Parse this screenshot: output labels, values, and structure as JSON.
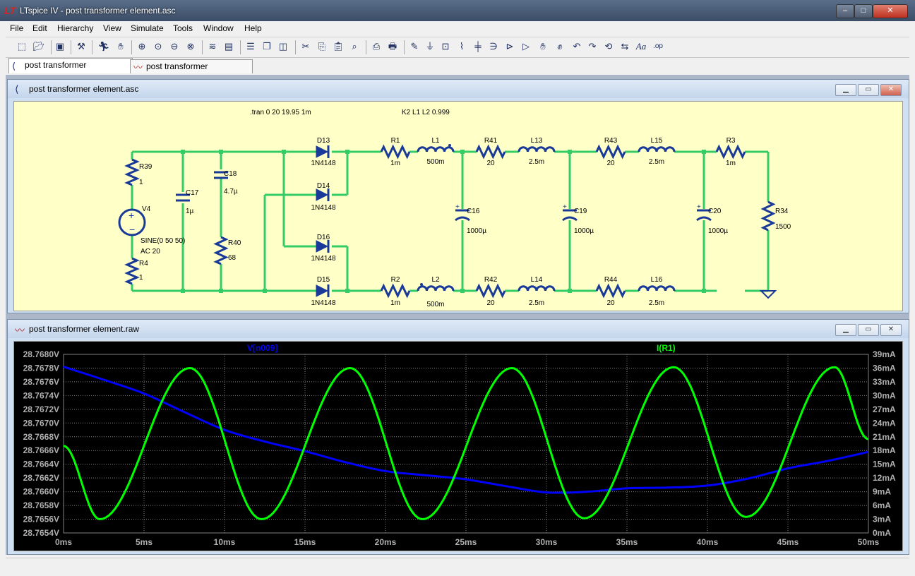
{
  "window": {
    "title": "LTspice IV - post transformer element.asc",
    "app_icon": "ltspice-logo-icon"
  },
  "menu": [
    "File",
    "Edit",
    "Hierarchy",
    "View",
    "Simulate",
    "Tools",
    "Window",
    "Help"
  ],
  "toolbar_icons": [
    "new-schematic-icon",
    "open-icon",
    "save-icon",
    "control-panel-icon",
    "run-icon",
    "halt-icon",
    "zoom-in-icon",
    "zoom-pan-icon",
    "zoom-out-icon",
    "zoom-cancel-icon",
    "autorange-icon",
    "view-netlist-icon",
    "tile-horizontal-icon",
    "cascade-icon",
    "tile-vertical-icon",
    "cut-icon",
    "copy-icon",
    "paste-icon",
    "find-icon",
    "print-setup-icon",
    "print-icon",
    "wire-icon",
    "ground-icon",
    "label-icon",
    "resistor-icon",
    "capacitor-icon",
    "inductor-icon",
    "diode-icon",
    "component-icon",
    "move-icon",
    "drag-icon",
    "undo-icon",
    "redo-icon",
    "rotate-icon",
    "mirror-icon",
    "text-icon",
    "spice-directive-icon"
  ],
  "tabs": [
    {
      "label": "post transformer element.asc",
      "icon": "schematic-icon",
      "active": true
    },
    {
      "label": "post transformer element.raw",
      "icon": "waveform-icon",
      "active": false
    }
  ],
  "schematic": {
    "title": "post transformer element.asc",
    "directives": [
      ".tran 0 20 19.95 1m",
      "K2 L1 L2 0.999"
    ],
    "components": [
      {
        "ref": "R39",
        "value": "1"
      },
      {
        "ref": "V4",
        "value": "SINE(0 50 50)"
      },
      {
        "ref": "V4_ac",
        "value": "AC 20"
      },
      {
        "ref": "R4",
        "value": "1"
      },
      {
        "ref": "C17",
        "value": "1µ"
      },
      {
        "ref": "C18",
        "value": "4.7µ"
      },
      {
        "ref": "R40",
        "value": "68"
      },
      {
        "ref": "D13",
        "value": "1N4148"
      },
      {
        "ref": "D14",
        "value": "1N4148"
      },
      {
        "ref": "D16",
        "value": "1N4148"
      },
      {
        "ref": "D15",
        "value": "1N4148"
      },
      {
        "ref": "R1",
        "value": "1m"
      },
      {
        "ref": "L1",
        "value": "500m"
      },
      {
        "ref": "R2",
        "value": "1m"
      },
      {
        "ref": "L2",
        "value": "500m"
      },
      {
        "ref": "C16",
        "value": "1000µ"
      },
      {
        "ref": "R41",
        "value": "20"
      },
      {
        "ref": "L13",
        "value": "2.5m"
      },
      {
        "ref": "R42",
        "value": "20"
      },
      {
        "ref": "L14",
        "value": "2.5m"
      },
      {
        "ref": "C19",
        "value": "1000µ"
      },
      {
        "ref": "R43",
        "value": "20"
      },
      {
        "ref": "L15",
        "value": "2.5m"
      },
      {
        "ref": "R44",
        "value": "20"
      },
      {
        "ref": "L16",
        "value": "2.5m"
      },
      {
        "ref": "C20",
        "value": "1000µ"
      },
      {
        "ref": "R3",
        "value": "1m"
      },
      {
        "ref": "R34",
        "value": "1500"
      }
    ],
    "colors": {
      "background": "#ffffc8",
      "wire": "#33cc66",
      "component": "#1a3a9a",
      "text": "#000000"
    }
  },
  "waveform": {
    "title": "post transformer element.raw",
    "colors": {
      "background": "#000000",
      "grid": "#808080",
      "trace1": "#0000ff",
      "trace2": "#00ff00"
    }
  },
  "chart_data": {
    "type": "line",
    "title": "",
    "xlabel": "",
    "x_unit": "ms",
    "xlim": [
      0,
      50
    ],
    "x_ticks": [
      "0ms",
      "5ms",
      "10ms",
      "15ms",
      "20ms",
      "25ms",
      "30ms",
      "35ms",
      "40ms",
      "45ms",
      "50ms"
    ],
    "left_axis": {
      "ylim": [
        28.7654,
        28.768
      ],
      "ticks": [
        "28.7680V",
        "28.7678V",
        "28.7676V",
        "28.7674V",
        "28.7672V",
        "28.7670V",
        "28.7668V",
        "28.7666V",
        "28.7664V",
        "28.7662V",
        "28.7660V",
        "28.7658V",
        "28.7656V",
        "28.7654V"
      ]
    },
    "right_axis": {
      "ylim": [
        0,
        39
      ],
      "ticks": [
        "39mA",
        "36mA",
        "33mA",
        "30mA",
        "27mA",
        "24mA",
        "21mA",
        "18mA",
        "15mA",
        "12mA",
        "9mA",
        "6mA",
        "3mA",
        "0mA"
      ]
    },
    "grid": true,
    "series": [
      {
        "name": "V[n009]",
        "axis": "left",
        "color": "#0000ff",
        "x": [
          0,
          2.5,
          5,
          7.5,
          10,
          12.5,
          15,
          17.5,
          20,
          22.5,
          25,
          27.5,
          30,
          32.5,
          35,
          37.5,
          40,
          42.5,
          45,
          47.5,
          50
        ],
        "y": [
          28.76782,
          28.76763,
          28.76743,
          28.76716,
          28.7669,
          28.76673,
          28.76659,
          28.76643,
          28.7663,
          28.76624,
          28.76618,
          28.76608,
          28.76599,
          28.766,
          28.76605,
          28.76606,
          28.76609,
          28.76619,
          28.76634,
          28.76645,
          28.76658
        ]
      },
      {
        "name": "I(R1)",
        "axis": "right",
        "color": "#00ff00",
        "x": [
          0,
          2.25,
          7.85,
          12.3,
          17.8,
          22.3,
          27.85,
          32.35,
          37.9,
          42.4,
          47.9,
          50
        ],
        "y": [
          19,
          3,
          36,
          3,
          36,
          3,
          36,
          3.2,
          36.2,
          3.5,
          36.2,
          20.5
        ]
      }
    ]
  }
}
